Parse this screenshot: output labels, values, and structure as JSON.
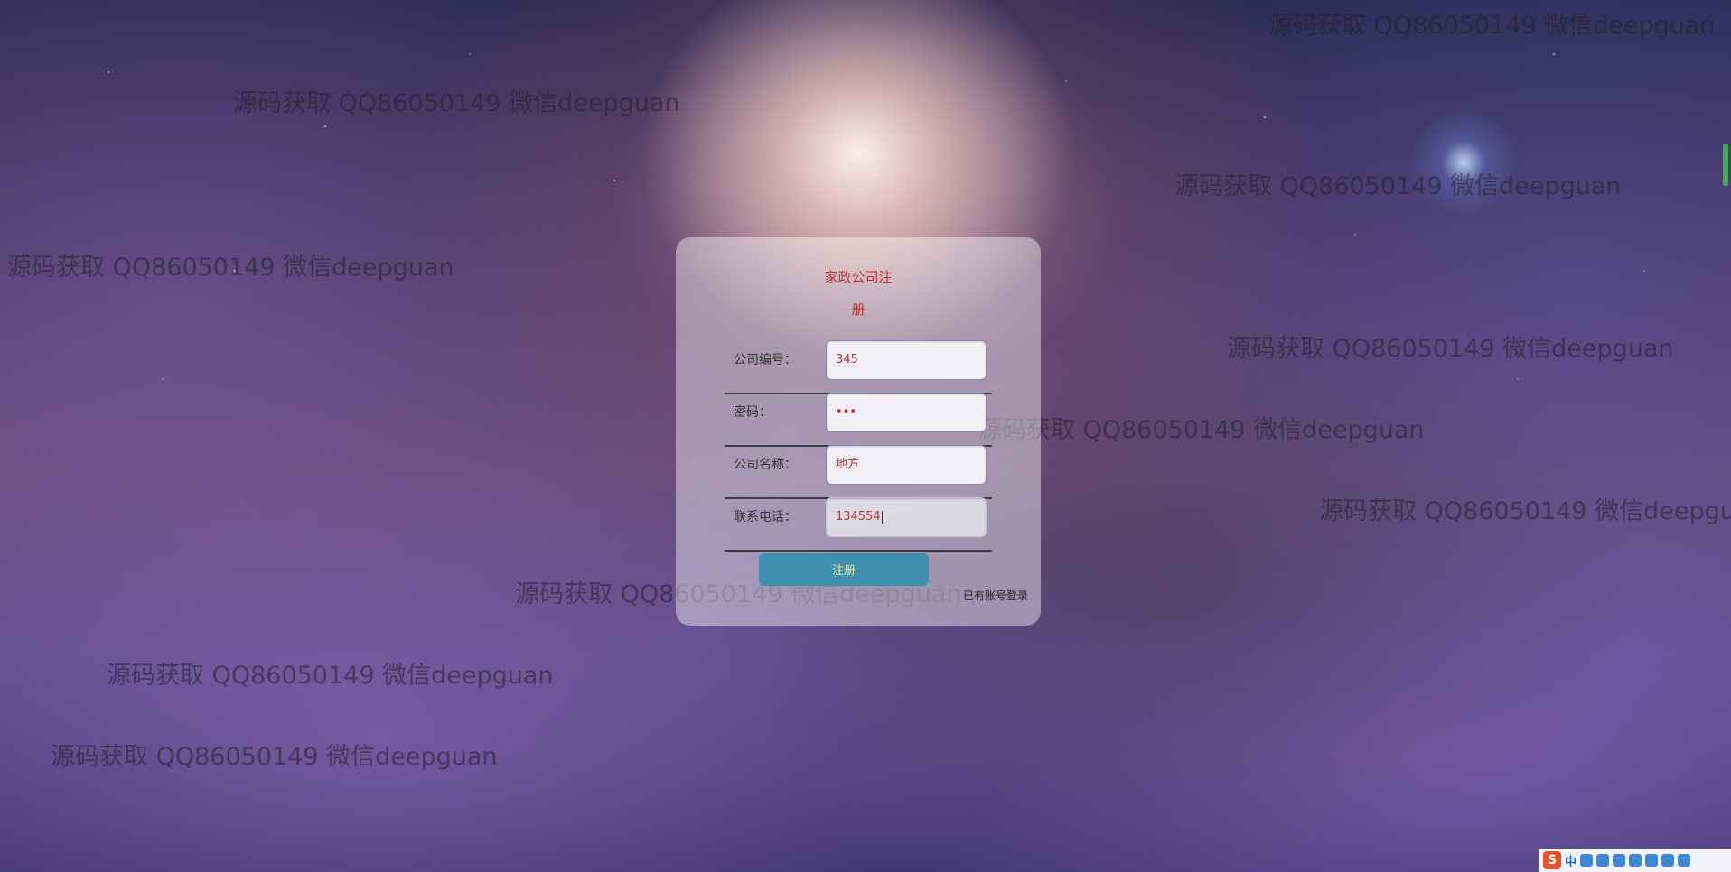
{
  "watermark": "源码获取 QQ86050149 微信deepguan",
  "form": {
    "title_line1": "家政公司注",
    "title_line2": "册",
    "fields": [
      {
        "label": "公司编号：",
        "value": "345"
      },
      {
        "label": "密码：",
        "value": "•••"
      },
      {
        "label": "公司名称：",
        "value": "地方"
      },
      {
        "label": "联系电话：",
        "value": "134554"
      }
    ],
    "submit_label": "注册",
    "login_link": "已有账号登录"
  },
  "tray": {
    "logo": "S",
    "ime": "中",
    "icons": [
      "moon-icon",
      "emoji-icon",
      "mic-icon",
      "keyboard-icon",
      "user-icon",
      "shirt-icon",
      "grid-icon"
    ]
  }
}
